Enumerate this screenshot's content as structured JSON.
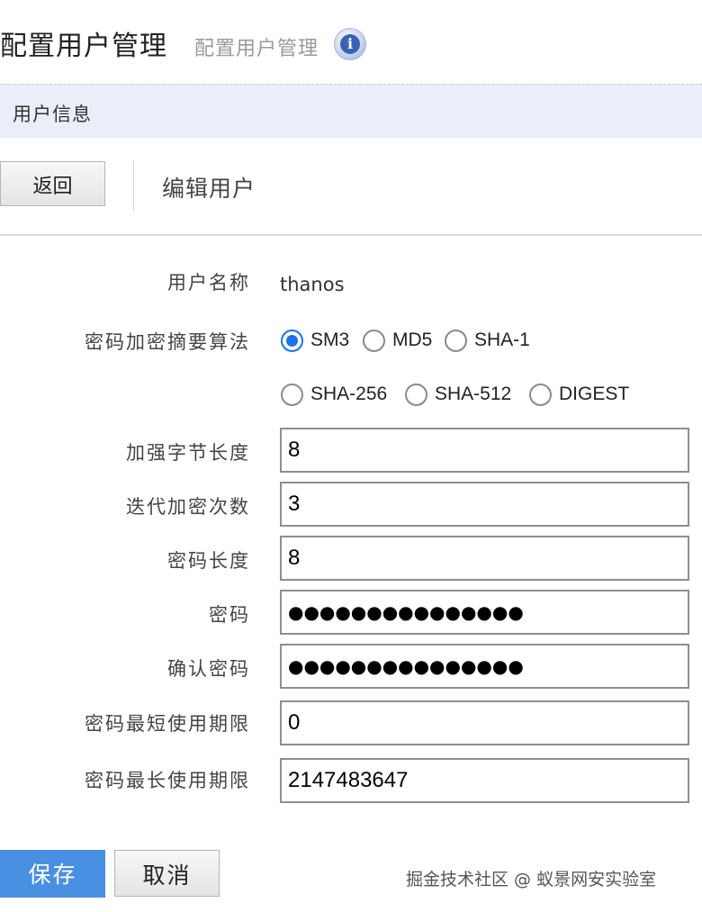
{
  "header": {
    "title": "配置用户管理",
    "subtitle": "配置用户管理",
    "info_icon": "info-icon",
    "info_glyph": "i"
  },
  "section": {
    "title": "用户信息"
  },
  "toolbar": {
    "back_label": "返回",
    "edit_title": "编辑用户"
  },
  "form": {
    "username_label": "用户名称",
    "username_value": "thanos",
    "algorithm_label": "密码加密摘要算法",
    "algorithm_options": [
      "SM3",
      "MD5",
      "SHA-1",
      "SHA-256",
      "SHA-512",
      "DIGEST"
    ],
    "algorithm_selected": "SM3",
    "salt_length_label": "加强字节长度",
    "salt_length_value": "8",
    "iterations_label": "迭代加密次数",
    "iterations_value": "3",
    "password_length_label": "密码长度",
    "password_length_value": "8",
    "password_label": "密码",
    "password_value": "●●●●●●●●●●●●●●●",
    "confirm_password_label": "确认密码",
    "confirm_password_value": "●●●●●●●●●●●●●●●",
    "min_age_label": "密码最短使用期限",
    "min_age_value": "0",
    "max_age_label": "密码最长使用期限",
    "max_age_value": "2147483647"
  },
  "actions": {
    "save_label": "保存",
    "cancel_label": "取消"
  },
  "watermark": "掘金技术社区 @ 蚁景网安实验室",
  "colors": {
    "accent": "#4a90e2",
    "radio_checked": "#1a73e8",
    "section_bg": "#e9eef9"
  }
}
